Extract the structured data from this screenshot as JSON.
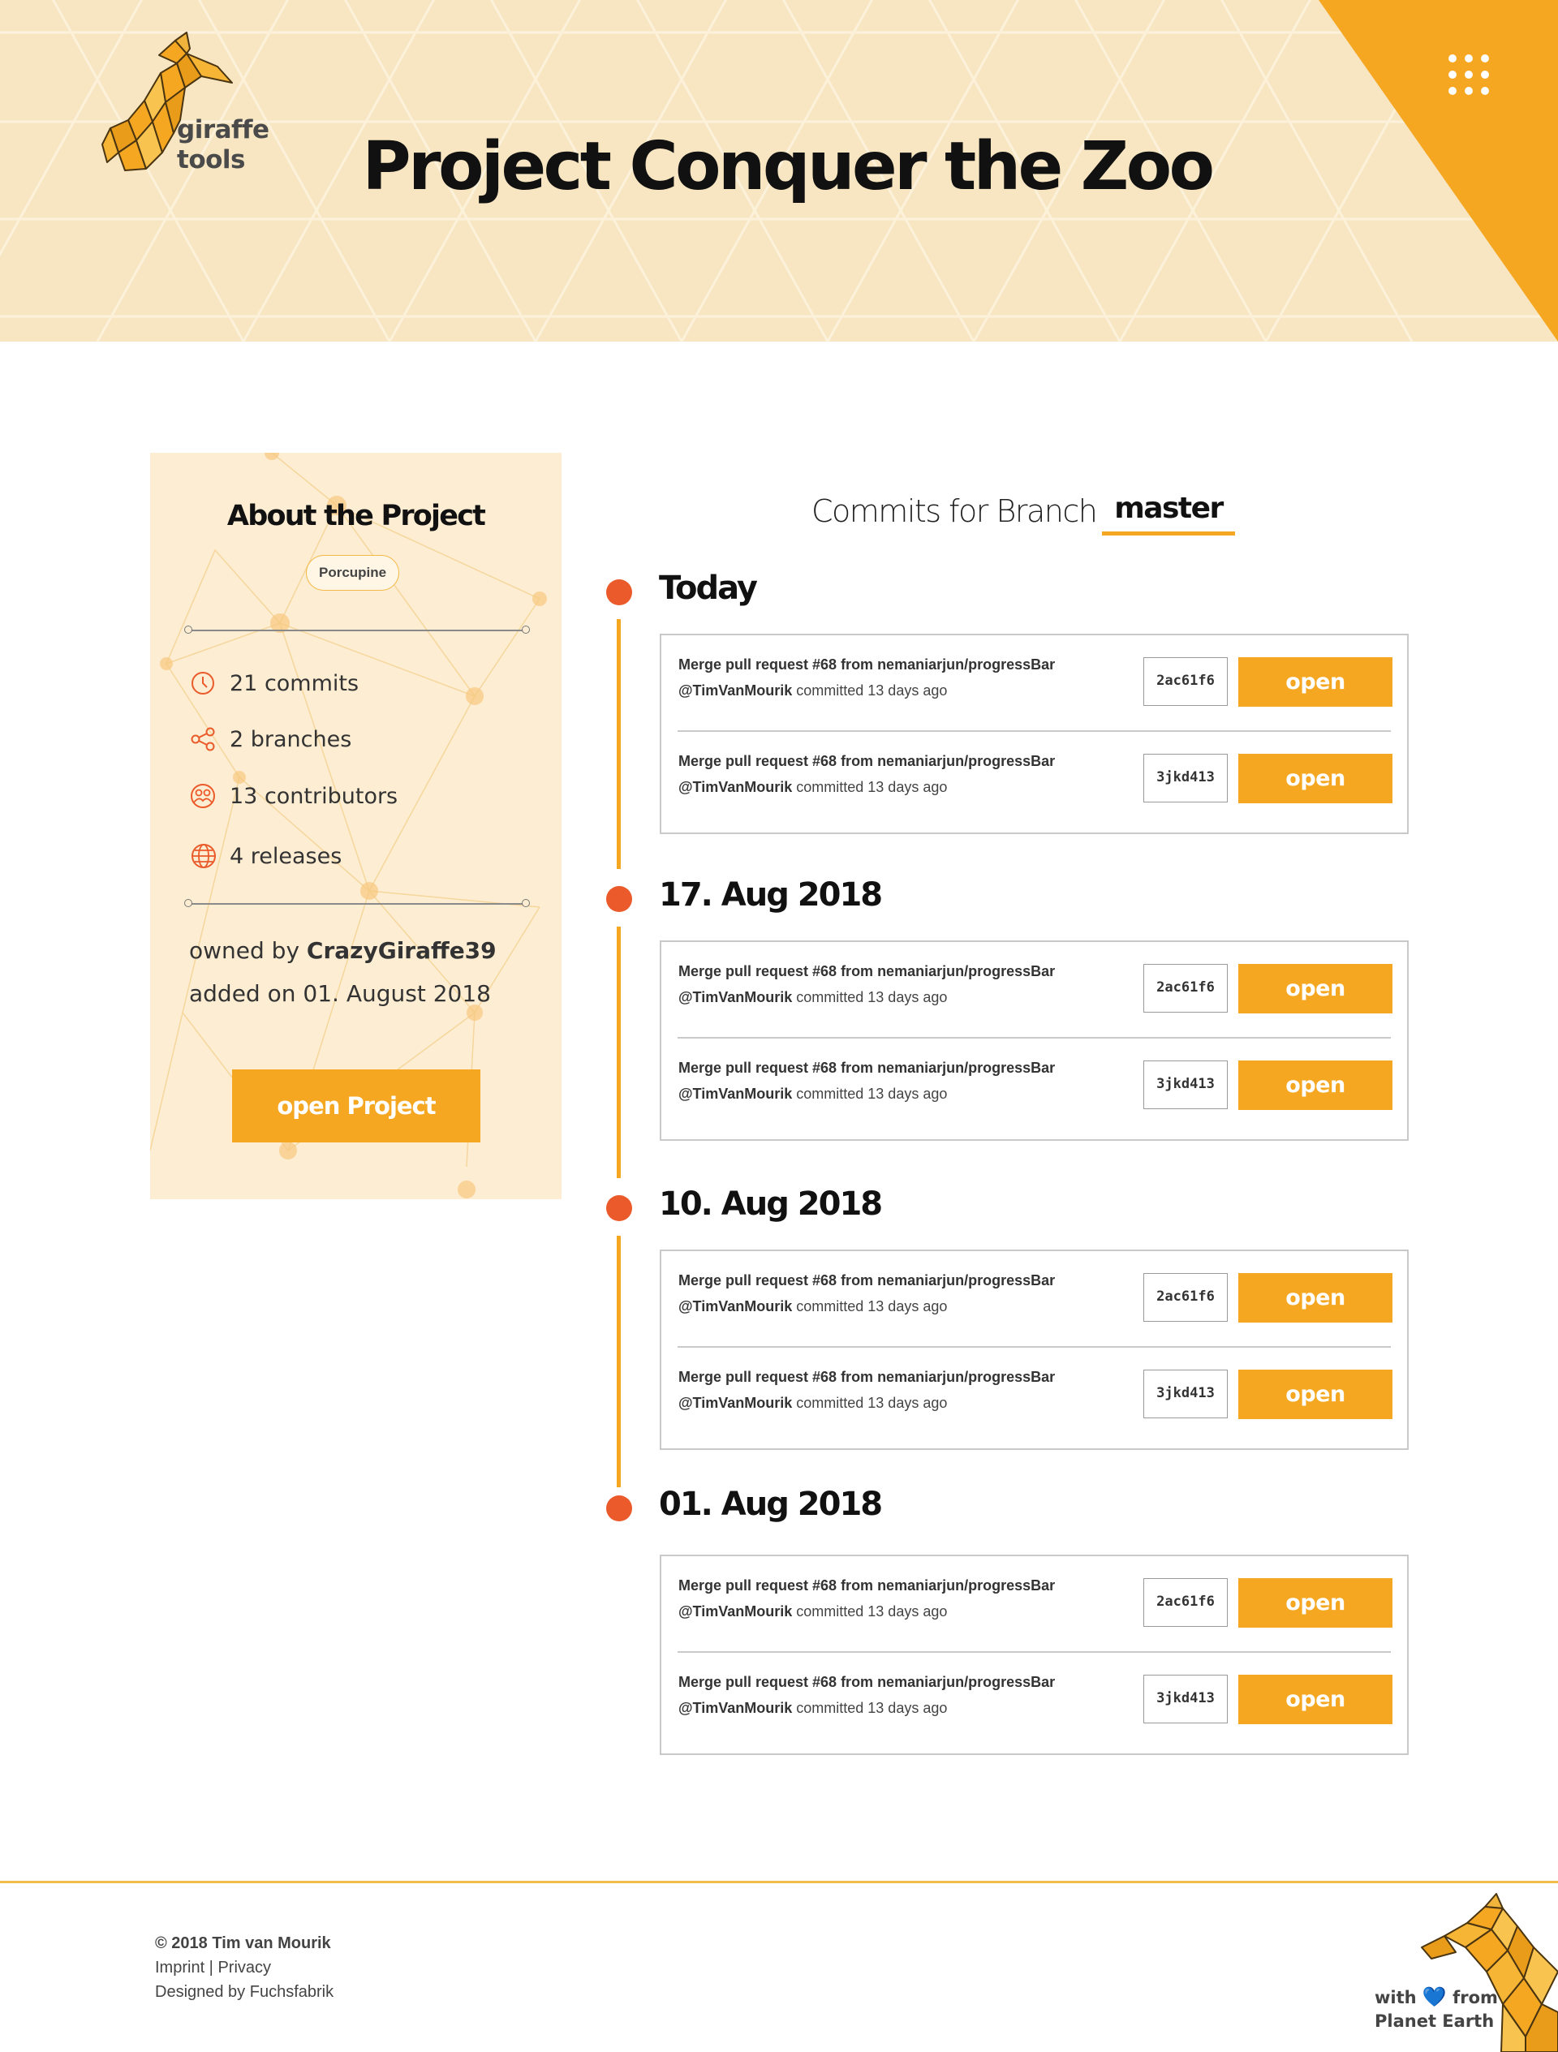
{
  "header": {
    "logo_line1": "giraffe",
    "logo_line2": "tools",
    "title": "Project Conquer the Zoo",
    "colors": {
      "accent": "#f5a722",
      "header_bg": "#f8e6c2",
      "marker": "#ea5a2b"
    }
  },
  "about": {
    "title": "About the Project",
    "tag": "Porcupine",
    "stats": [
      {
        "icon": "clock-icon",
        "text": "21 commits"
      },
      {
        "icon": "share-icon",
        "text": "2 branches"
      },
      {
        "icon": "people-icon",
        "text": "13 contributors"
      },
      {
        "icon": "globe-icon",
        "text": "4 releases"
      }
    ],
    "owned_prefix": "owned by ",
    "owner": "CrazyGiraffe39",
    "added": "added on 01. August 2018",
    "open_button": "open Project"
  },
  "commits": {
    "heading": "Commits for Branch",
    "branch": "master",
    "groups": [
      {
        "date": "Today",
        "items": [
          {
            "message": "Merge pull request #68 from nemaniarjun/progressBar",
            "author": "@TimVanMourik",
            "action": "committed 13 days ago",
            "hash": "2ac61f6",
            "button": "open"
          },
          {
            "message": "Merge pull request #68 from nemaniarjun/progressBar",
            "author": "@TimVanMourik",
            "action": "committed 13 days ago",
            "hash": "3jkd413",
            "button": "open"
          }
        ]
      },
      {
        "date": "17. Aug 2018",
        "items": [
          {
            "message": "Merge pull request #68 from nemaniarjun/progressBar",
            "author": "@TimVanMourik",
            "action": "committed 13 days ago",
            "hash": "2ac61f6",
            "button": "open"
          },
          {
            "message": "Merge pull request #68 from nemaniarjun/progressBar",
            "author": "@TimVanMourik",
            "action": "committed 13 days ago",
            "hash": "3jkd413",
            "button": "open"
          }
        ]
      },
      {
        "date": "10. Aug 2018",
        "items": [
          {
            "message": "Merge pull request #68 from nemaniarjun/progressBar",
            "author": "@TimVanMourik",
            "action": "committed 13 days ago",
            "hash": "2ac61f6",
            "button": "open"
          },
          {
            "message": "Merge pull request #68 from nemaniarjun/progressBar",
            "author": "@TimVanMourik",
            "action": "committed 13 days ago",
            "hash": "3jkd413",
            "button": "open"
          }
        ]
      },
      {
        "date": "01. Aug 2018",
        "items": [
          {
            "message": "Merge pull request #68 from nemaniarjun/progressBar",
            "author": "@TimVanMourik",
            "action": "committed 13 days ago",
            "hash": "2ac61f6",
            "button": "open"
          },
          {
            "message": "Merge pull request #68 from nemaniarjun/progressBar",
            "author": "@TimVanMourik",
            "action": "committed 13 days ago",
            "hash": "3jkd413",
            "button": "open"
          }
        ]
      }
    ]
  },
  "footer": {
    "copyright": "© 2018 Tim van Mourik",
    "imprint": "Imprint",
    "separator": " | ",
    "privacy": "Privacy",
    "designed": "Designed by Fuchsfabrik",
    "made_with": "with",
    "heart": "💙",
    "made_from": "from",
    "made_place": "Planet Earth"
  }
}
